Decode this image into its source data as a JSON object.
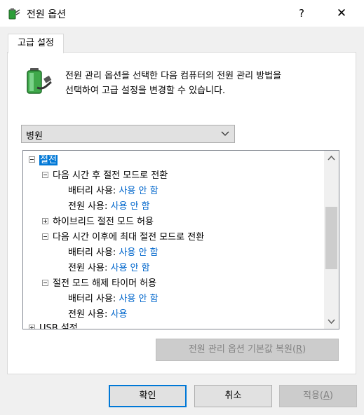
{
  "window": {
    "title": "전원 옵션",
    "help_label": "?",
    "close_label": "✕"
  },
  "tab": {
    "label": "고급 설정"
  },
  "description": {
    "line1": "전원 관리 옵션을 선택한 다음 컴퓨터의 전원 관리 방법을",
    "line2": "선택하여 고급 설정을 변경할 수 있습니다."
  },
  "plan_select": {
    "value": "병원"
  },
  "tree": {
    "root": "절전",
    "item1": "다음 시간 후 절전 모드로 전환",
    "item1_battery_label": "배터리 사용:",
    "item1_battery_value": "사용 안 함",
    "item1_ac_label": "전원 사용:",
    "item1_ac_value": "사용 안 함",
    "item2": "하이브리드 절전 모드 허용",
    "item3": "다음 시간 이후에 최대 절전 모드로 전환",
    "item3_battery_label": "배터리 사용:",
    "item3_battery_value": "사용 안 함",
    "item3_ac_label": "전원 사용:",
    "item3_ac_value": "사용 안 함",
    "item4": "절전 모드 해제 타이머 허용",
    "item4_battery_label": "배터리 사용:",
    "item4_battery_value": "사용 안 함",
    "item4_ac_label": "전원 사용:",
    "item4_ac_value": "사용",
    "next_root": "USB 설정"
  },
  "buttons": {
    "restore_label": "전원 관리 옵션 기본값 복원",
    "restore_key": "R",
    "ok_label": "확인",
    "cancel_label": "취소",
    "apply_label": "적용",
    "apply_key": "A"
  },
  "icons": {
    "app": "power-options-icon",
    "battery": "battery-plug-icon"
  }
}
